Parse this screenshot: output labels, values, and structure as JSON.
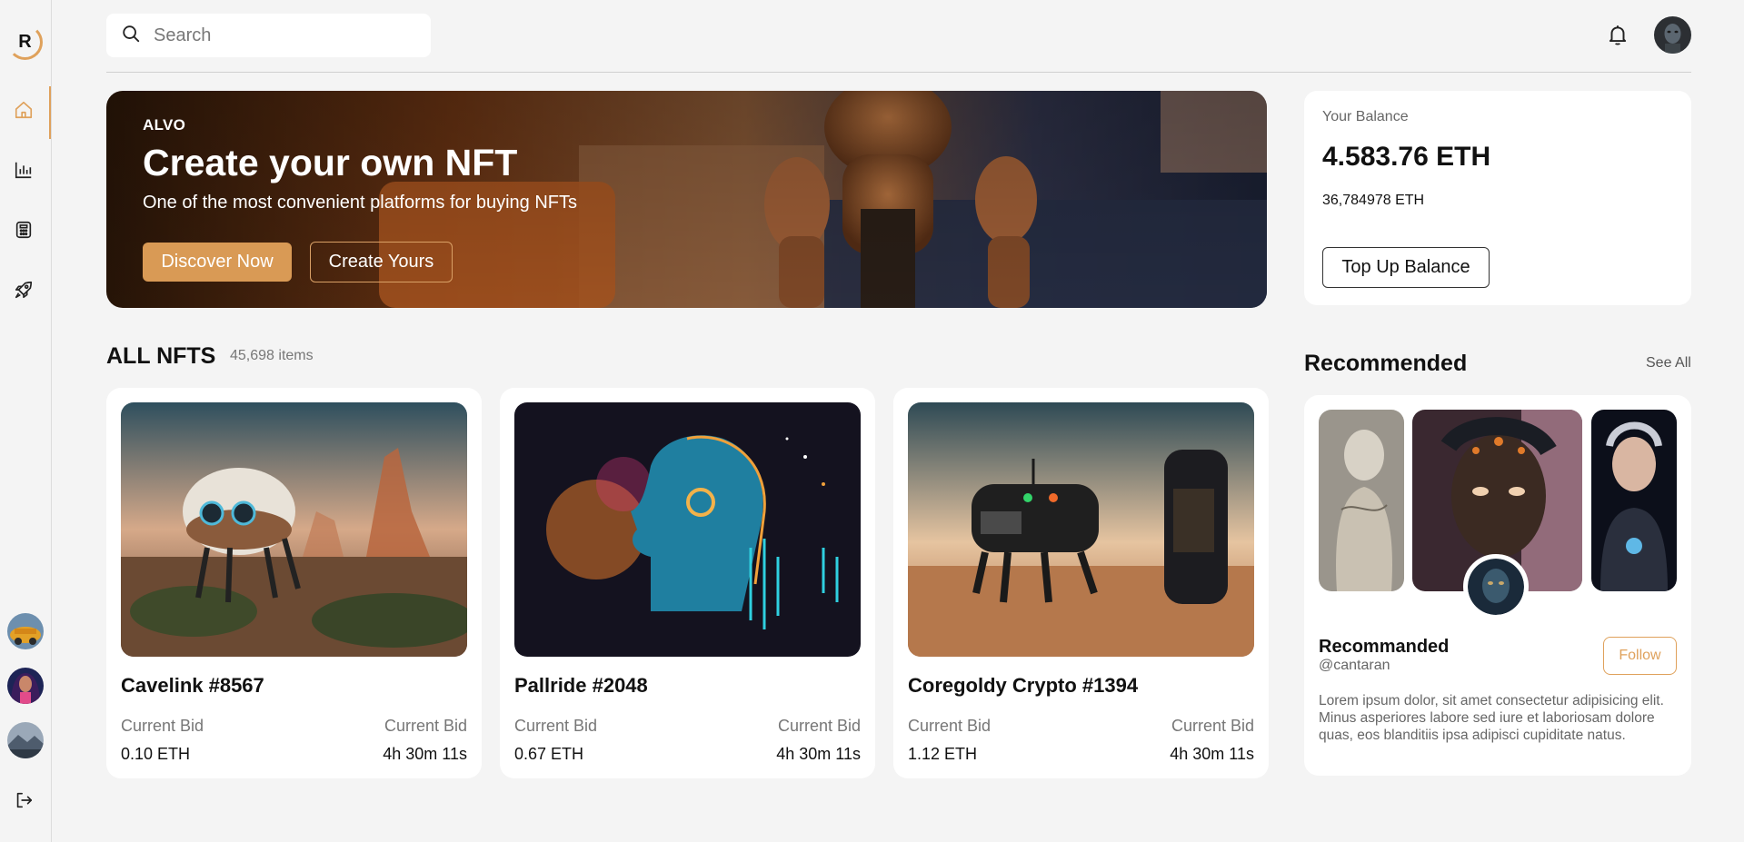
{
  "sidebar": {
    "logo_letter": "R",
    "icons": [
      "home-icon",
      "chart-icon",
      "calculator-icon",
      "rocket-icon"
    ],
    "logout_icon": "logout-icon"
  },
  "header": {
    "search_placeholder": "Search",
    "notification_icon": "bell-icon"
  },
  "hero": {
    "brand": "ALVO",
    "title": "Create your own NFT",
    "subtitle": "One of the most convenient platforms for buying NFTs",
    "primary_button": "Discover Now",
    "secondary_button": "Create Yours"
  },
  "balance": {
    "label": "Your Balance",
    "value": "4.583.76 ETH",
    "sub_value": "36,784978 ETH",
    "button": "Top Up Balance"
  },
  "nfts": {
    "title": "ALL NFTS",
    "count": "45,698 items",
    "items": [
      {
        "name": "Cavelink #8567",
        "bid_label": "Current Bid",
        "bid": "0.10 ETH",
        "time_label": "Current Bid",
        "time": "4h 30m 11s"
      },
      {
        "name": "Pallride #2048",
        "bid_label": "Current Bid",
        "bid": "0.67 ETH",
        "time_label": "Current Bid",
        "time": "4h 30m 11s"
      },
      {
        "name": "Coregoldy Crypto #1394",
        "bid_label": "Current Bid",
        "bid": "1.12 ETH",
        "time_label": "Current Bid",
        "time": "4h 30m 11s"
      }
    ]
  },
  "recommended": {
    "title": "Recommended",
    "see_all": "See All",
    "name": "Recommanded",
    "handle": "@cantaran",
    "follow_button": "Follow",
    "description": "Lorem ipsum dolor, sit amet consectetur adipisicing elit. Minus asperiores labore sed iure et laboriosam dolore quas, eos blanditiis ipsa adipisci cupiditate natus."
  },
  "colors": {
    "accent": "#dfa15b",
    "button_orange": "#d99a55",
    "background": "#f4f4f4",
    "card": "#ffffff"
  }
}
